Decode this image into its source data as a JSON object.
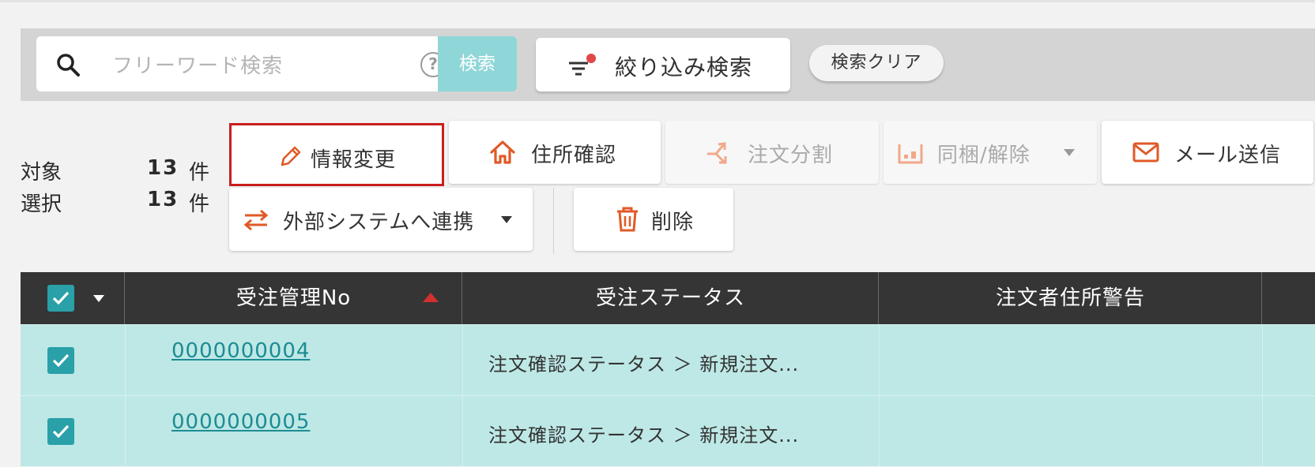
{
  "search": {
    "placeholder": "フリーワード検索",
    "help_icon": "?",
    "search_button": "検索",
    "filter_button": "絞り込み検索",
    "clear_button": "検索クリア"
  },
  "counts": {
    "target_label": "対象",
    "target_value": "13",
    "selected_label": "選択",
    "selected_value": "13",
    "unit": "件"
  },
  "actions": {
    "edit_info": "情報変更",
    "address_check": "住所確認",
    "split_order": "注文分割",
    "bundle": "同梱/解除",
    "send_mail": "メール送信",
    "external_link": "外部システムへ連携",
    "delete": "削除"
  },
  "table": {
    "columns": [
      "受注管理No",
      "受注ステータス",
      "注文者住所警告"
    ],
    "rows": [
      {
        "order_no": "0000000004",
        "status": "注文確認ステータス ＞ 新規注文..."
      },
      {
        "order_no": "0000000005",
        "status": "注文確認ステータス ＞ 新規注文..."
      }
    ]
  },
  "colors": {
    "accent": "#e05a28",
    "teal": "#2aa0a8",
    "row_selected": "#bde8e6",
    "header": "#353535",
    "highlight_border": "#c81e1e"
  }
}
